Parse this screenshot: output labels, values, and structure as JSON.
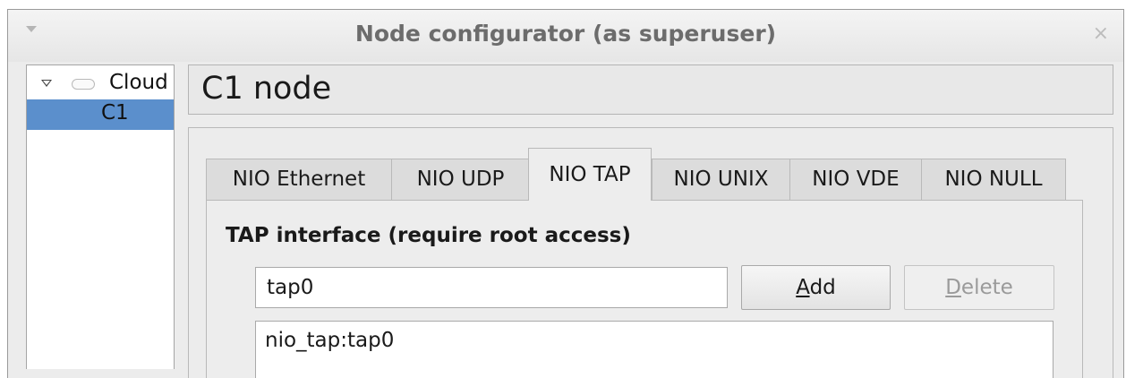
{
  "window": {
    "title": "Node configurator (as superuser)"
  },
  "tree": {
    "parent": {
      "label": "Cloud",
      "icon": "cloud-icon",
      "expanded": true
    },
    "children": [
      {
        "label": "C1",
        "selected": true
      }
    ]
  },
  "header": {
    "title": "C1 node"
  },
  "tabs": [
    {
      "label": "NIO Ethernet"
    },
    {
      "label": "NIO UDP"
    },
    {
      "label": "NIO TAP",
      "active": true
    },
    {
      "label": "NIO UNIX"
    },
    {
      "label": "NIO VDE"
    },
    {
      "label": "NIO NULL"
    }
  ],
  "tap": {
    "section_title": "TAP interface (require root access)",
    "input_value": "tap0",
    "add_prefix": "",
    "add_mnemonic": "A",
    "add_rest": "dd",
    "delete_prefix": "",
    "delete_mnemonic": "D",
    "delete_rest": "elete",
    "delete_enabled": false,
    "items": [
      "nio_tap:tap0"
    ]
  },
  "colors": {
    "selection": "#5b8fcc",
    "window_bg": "#ececec"
  }
}
